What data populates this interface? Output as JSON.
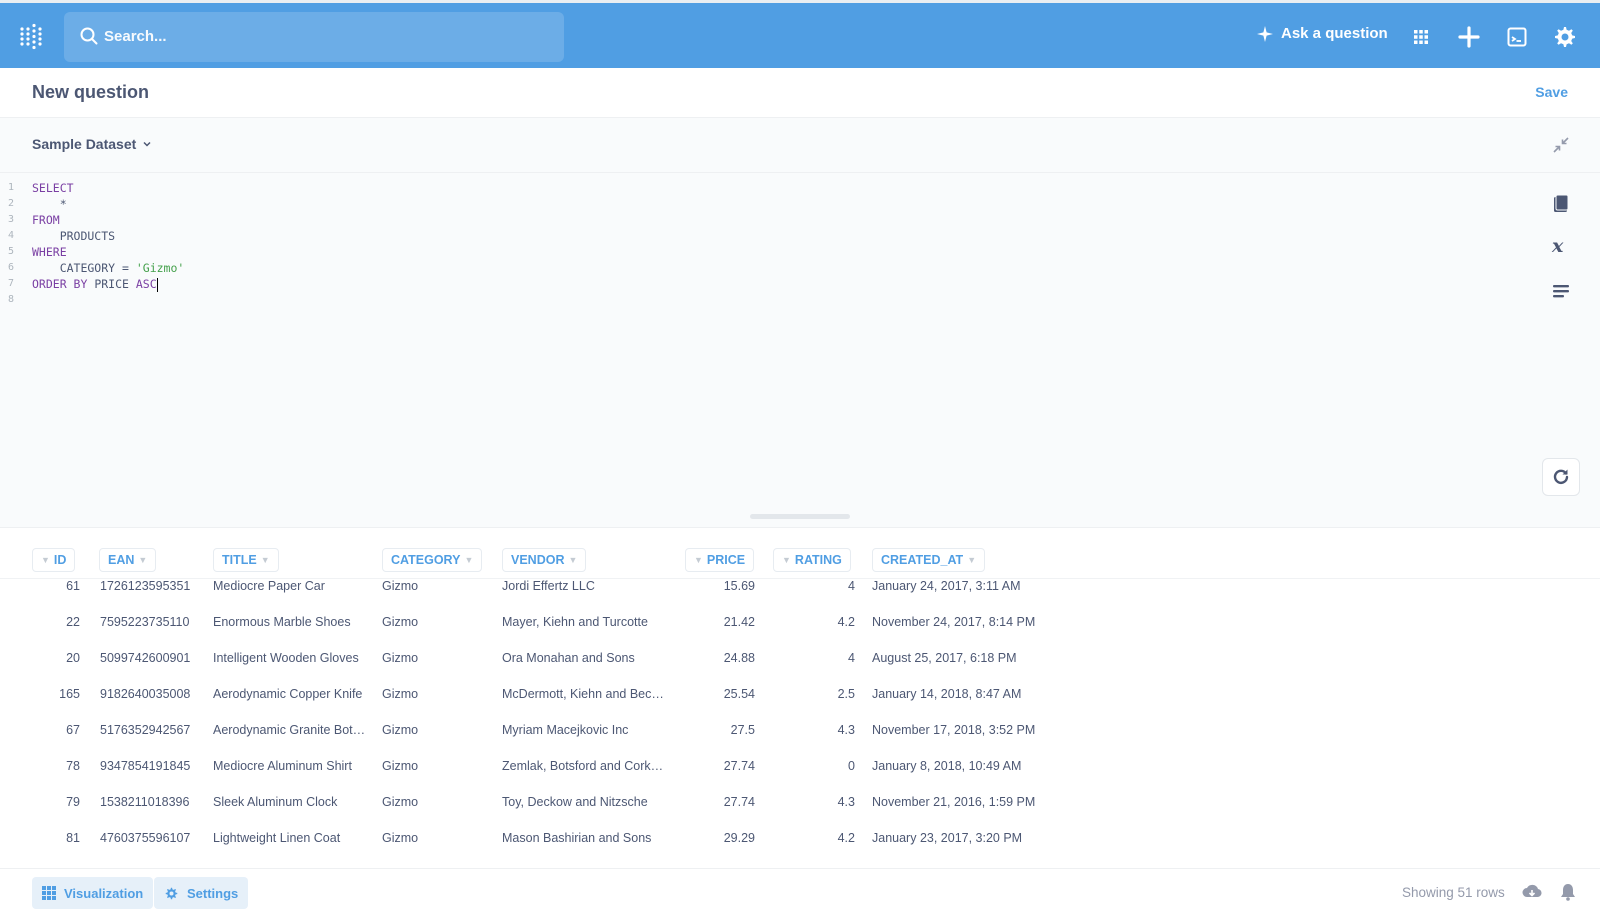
{
  "nav": {
    "search_placeholder": "Search...",
    "ask_label": "Ask a question",
    "icons": [
      "grid-icon",
      "plus-icon",
      "browse-icon",
      "gear-icon"
    ]
  },
  "header": {
    "title": "New question",
    "save_label": "Save"
  },
  "editor": {
    "database": "Sample Dataset",
    "line_numbers": [
      "1",
      "2",
      "3",
      "4",
      "5",
      "6",
      "7",
      "8"
    ]
  },
  "table": {
    "columns": [
      "ID",
      "EAN",
      "TITLE",
      "CATEGORY",
      "VENDOR",
      "PRICE",
      "RATING",
      "CREATED_AT"
    ],
    "rows": [
      [
        "61",
        "1726123595351",
        "Mediocre Paper Car",
        "Gizmo",
        "Jordi Effertz LLC",
        "15.69",
        "4",
        "January 24, 2017, 3:11 AM"
      ],
      [
        "22",
        "7595223735110",
        "Enormous Marble Shoes",
        "Gizmo",
        "Mayer, Kiehn and Turcotte",
        "21.42",
        "4.2",
        "November 24, 2017, 8:14 PM"
      ],
      [
        "20",
        "5099742600901",
        "Intelligent Wooden Gloves",
        "Gizmo",
        "Ora Monahan and Sons",
        "24.88",
        "4",
        "August 25, 2017, 6:18 PM"
      ],
      [
        "165",
        "9182640035008",
        "Aerodynamic Copper Knife",
        "Gizmo",
        "McDermott, Kiehn and Bec…",
        "25.54",
        "2.5",
        "January 14, 2018, 8:47 AM"
      ],
      [
        "67",
        "5176352942567",
        "Aerodynamic Granite Bot…",
        "Gizmo",
        "Myriam Macejkovic Inc",
        "27.5",
        "4.3",
        "November 17, 2018, 3:52 PM"
      ],
      [
        "78",
        "9347854191845",
        "Mediocre Aluminum Shirt",
        "Gizmo",
        "Zemlak, Botsford and Cork…",
        "27.74",
        "0",
        "January 8, 2018, 10:49 AM"
      ],
      [
        "79",
        "1538211018396",
        "Sleek Aluminum Clock",
        "Gizmo",
        "Toy, Deckow and Nitzsche",
        "27.74",
        "4.3",
        "November 21, 2016, 1:59 PM"
      ],
      [
        "81",
        "4760375596107",
        "Lightweight Linen Coat",
        "Gizmo",
        "Mason Bashirian and Sons",
        "29.29",
        "4.2",
        "January 23, 2017, 3:20 PM"
      ]
    ]
  },
  "footer": {
    "visualization_label": "Visualization",
    "settings_label": "Settings",
    "rows_label": "Showing 51 rows"
  },
  "colors": {
    "brand": "#509ee3",
    "text": "#4c5773",
    "keyword": "#7a3fa3",
    "string": "#44a04b"
  }
}
